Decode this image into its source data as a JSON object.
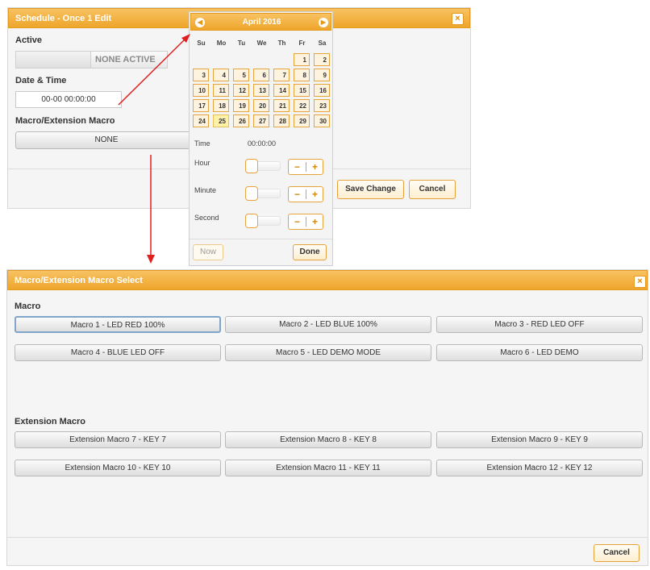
{
  "schedule_dialog": {
    "title": "Schedule - Once 1 Edit",
    "active_label": "Active",
    "active_value": "NONE ACTIVE",
    "datetime_label": "Date & Time",
    "datetime_value": "00-00 00:00:00",
    "macro_label": "Macro/Extension Macro",
    "macro_value": "NONE",
    "save_label": "Save Change",
    "cancel_label": "Cancel"
  },
  "calendar": {
    "month_title": "April 2016",
    "weekdays": [
      "Su",
      "Mo",
      "Tu",
      "We",
      "Th",
      "Fr",
      "Sa"
    ],
    "weeks": [
      [
        "",
        "",
        "",
        "",
        "",
        "1",
        "2"
      ],
      [
        "3",
        "4",
        "5",
        "6",
        "7",
        "8",
        "9"
      ],
      [
        "10",
        "11",
        "12",
        "13",
        "14",
        "15",
        "16"
      ],
      [
        "17",
        "18",
        "19",
        "20",
        "21",
        "22",
        "23"
      ],
      [
        "24",
        "25",
        "26",
        "27",
        "28",
        "29",
        "30"
      ]
    ],
    "today": "25",
    "time_label": "Time",
    "time_value": "00:00:00",
    "hour_label": "Hour",
    "minute_label": "Minute",
    "second_label": "Second",
    "minus": "−",
    "plus": "+",
    "now_label": "Now",
    "done_label": "Done"
  },
  "macro_dialog": {
    "title": "Macro/Extension Macro Select",
    "macro_section_label": "Macro",
    "macros": [
      "Macro 1 - LED RED 100%",
      "Macro 2 - LED BLUE 100%",
      "Macro 3 - RED LED OFF",
      "Macro 4 - BLUE LED OFF",
      "Macro 5 - LED DEMO MODE",
      "Macro 6 - LED DEMO"
    ],
    "extension_section_label": "Extension Macro",
    "extension_macros": [
      "Extension Macro 7 - KEY 7",
      "Extension Macro 8 - KEY 8",
      "Extension Macro 9 - KEY 9",
      "Extension Macro 10 - KEY 10",
      "Extension Macro 11 - KEY 11",
      "Extension Macro 12 - KEY 12"
    ],
    "cancel_label": "Cancel"
  },
  "colors": {
    "accent": "#eea52a",
    "arrow": "#e02020"
  },
  "close_icon": "×"
}
